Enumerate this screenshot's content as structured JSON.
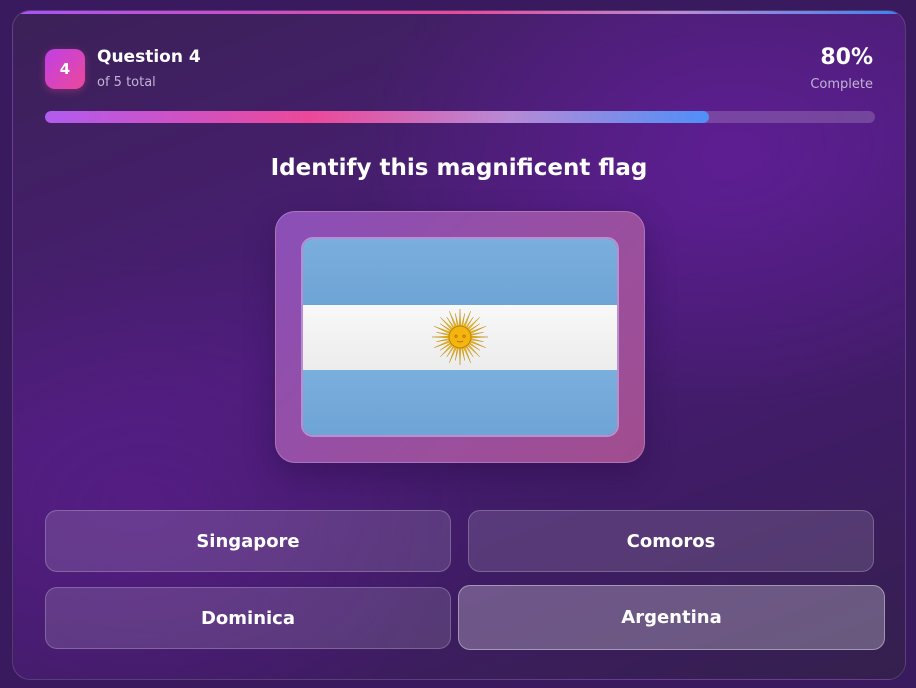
{
  "quiz": {
    "question_number": "4",
    "question_title": "Question 4",
    "question_subtitle": "of 5 total",
    "progress_percent_label": "80%",
    "progress_status": "Complete",
    "progress_fraction": 0.8,
    "prompt": "Identify this magnificent flag",
    "flag_icon": "argentina-flag-icon",
    "answers": [
      {
        "label": "Singapore"
      },
      {
        "label": "Comoros"
      },
      {
        "label": "Dominica"
      },
      {
        "label": "Argentina"
      }
    ]
  },
  "colors": {
    "accent_pink": "#ec4899",
    "accent_purple": "#a855f7",
    "accent_blue": "#3b82f6",
    "flag_blue": "#74acdf",
    "flag_white": "#f4f4f4",
    "flag_sun": "#f6b40e"
  }
}
